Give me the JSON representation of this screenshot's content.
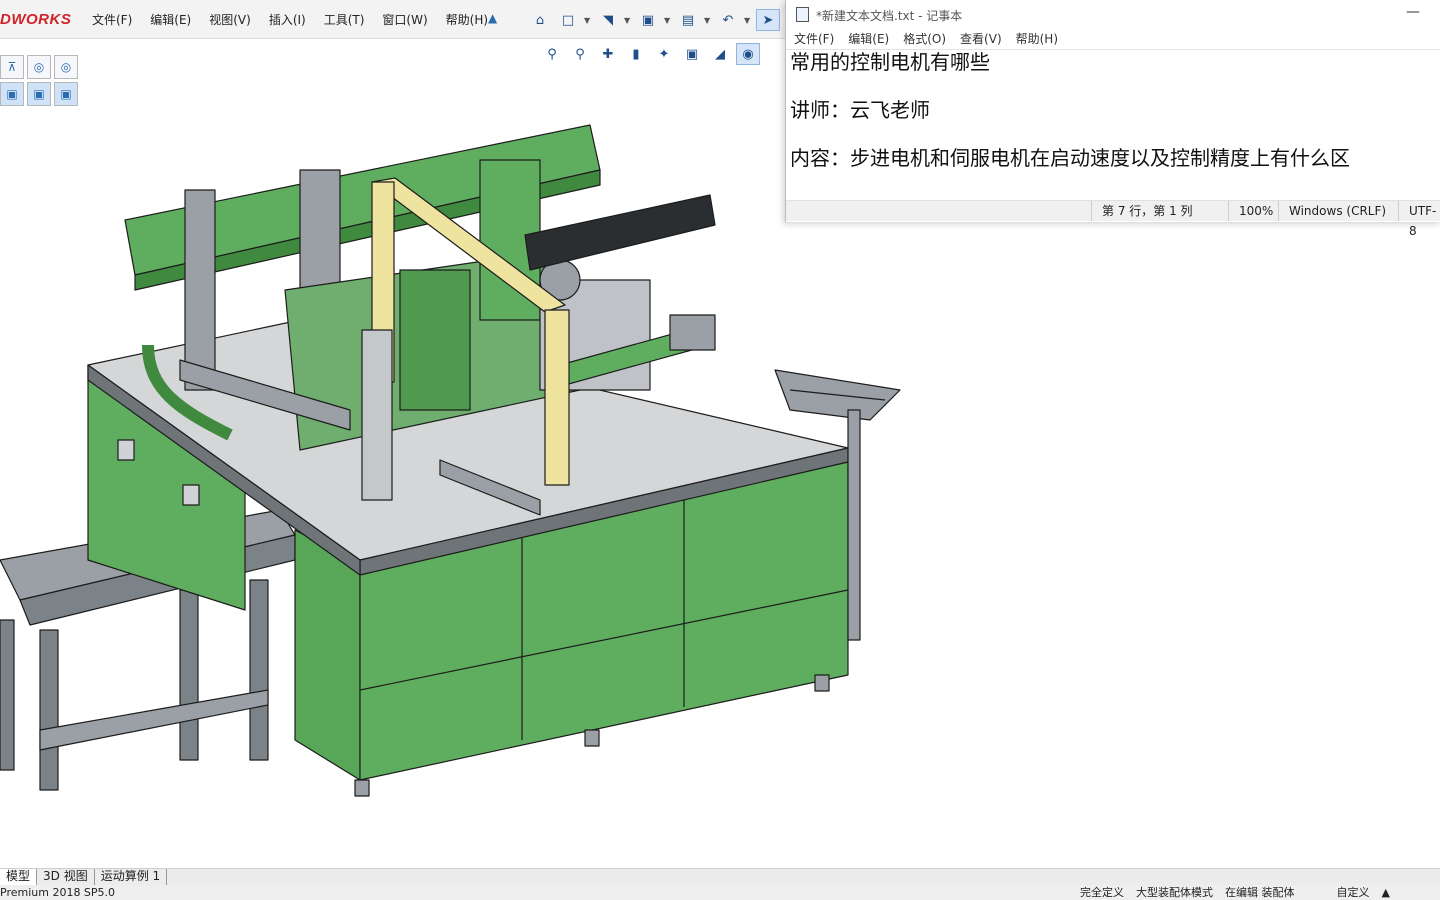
{
  "app": {
    "logo": "DWORKS",
    "menus": [
      "文件(F)",
      "编辑(E)",
      "视图(V)",
      "插入(I)",
      "工具(T)",
      "窗口(W)",
      "帮助(H)"
    ]
  },
  "toolbar": {
    "icons": [
      "home-icon",
      "new-document-icon",
      "open-folder-icon",
      "save-icon",
      "print-icon",
      "undo-icon",
      "select-arrow-icon"
    ],
    "view_icons": [
      "zoom-fit-icon",
      "zoom-area-icon",
      "previous-view-icon",
      "section-view-icon",
      "dynamic-annotation-icon",
      "view-orientation-icon",
      "display-style-icon",
      "hide-show-icon"
    ]
  },
  "bottom_tabs": [
    "模型",
    "3D 视图",
    "运动算例 1"
  ],
  "statusbar": {
    "product": "Premium 2018 SP5.0",
    "definition": "完全定义",
    "mode": "大型装配体模式",
    "editing": "在编辑 装配体",
    "custom": "自定义"
  },
  "notepad": {
    "title": "*新建文本文档.txt - 记事本",
    "menus": [
      "文件(F)",
      "编辑(E)",
      "格式(O)",
      "查看(V)",
      "帮助(H)"
    ],
    "lines": [
      "常用的控制电机有哪些",
      "",
      "讲师：云飞老师",
      "",
      "内容：步进电机和伺服电机在启动速度以及控制精度上有什么区"
    ],
    "status": {
      "position": "第 7 行，第 1 列",
      "zoom": "100%",
      "line_ending": "Windows (CRLF)",
      "encoding": "UTF-8"
    }
  },
  "colors": {
    "machine_green": "#5fae5f",
    "frame_gray": "#8e949a",
    "table_top": "#d4d6d8",
    "beam_yellow": "#efe3a0",
    "logo_red": "#d2232a"
  }
}
